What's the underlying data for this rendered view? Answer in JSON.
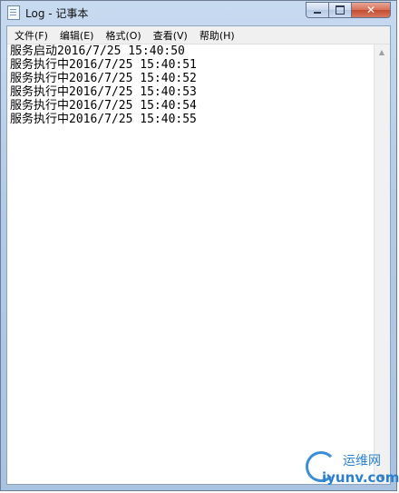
{
  "window": {
    "title": "Log - 记事本",
    "icon": "notepad-icon",
    "caption_buttons": {
      "minimize": "minimize-icon",
      "maximize": "maximize-icon",
      "close": "close-icon"
    }
  },
  "menu": {
    "items": [
      {
        "label": "文件(F)"
      },
      {
        "label": "编辑(E)"
      },
      {
        "label": "格式(O)"
      },
      {
        "label": "查看(V)"
      },
      {
        "label": "帮助(H)"
      }
    ]
  },
  "editor": {
    "lines": [
      "服务启动2016/7/25 15:40:50",
      "服务执行中2016/7/25 15:40:51",
      "服务执行中2016/7/25 15:40:52",
      "服务执行中2016/7/25 15:40:53",
      "服务执行中2016/7/25 15:40:54",
      "服务执行中2016/7/25 15:40:55"
    ]
  },
  "watermark": {
    "top": "运维网",
    "bottom": "iyunv.com"
  },
  "colors": {
    "titlebar": "#b4cbe6",
    "close_button": "#c34b30",
    "watermark": "#2a7fd0"
  }
}
